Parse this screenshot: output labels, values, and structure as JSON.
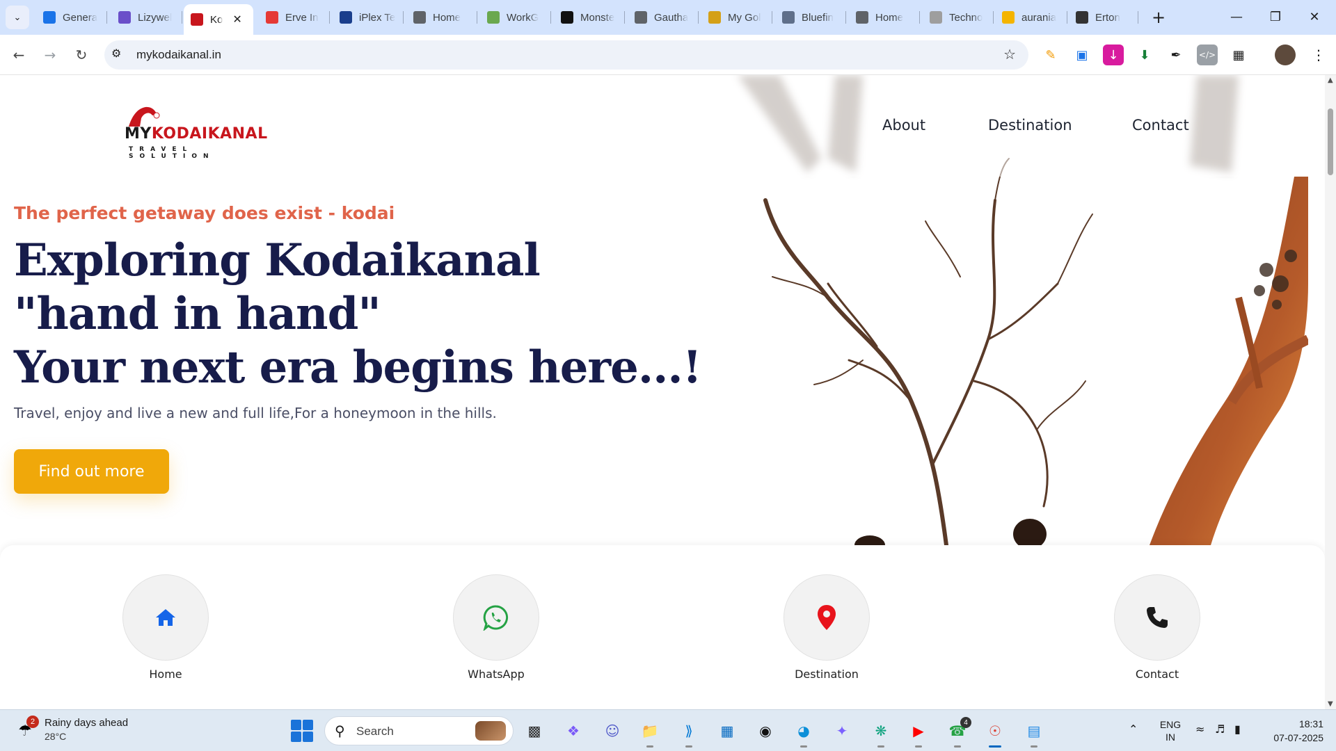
{
  "browser": {
    "tabs": [
      {
        "label": "Genera",
        "favicon": "chart-favicon",
        "favicon_color": "#1a73e8"
      },
      {
        "label": "Lizywel",
        "favicon": "lizywel-favicon",
        "favicon_color": "#6a4fc9"
      },
      {
        "label": "Ko",
        "favicon": "mykodaikanal-favicon",
        "favicon_color": "#c8161d",
        "active": true
      },
      {
        "label": "Erve In",
        "favicon": "erve-favicon",
        "favicon_color": "#e53935"
      },
      {
        "label": "iPlex Te",
        "favicon": "iplex-favicon",
        "favicon_color": "#1a3e8c"
      },
      {
        "label": "Home",
        "favicon": "globe-favicon",
        "favicon_color": "#5f6368"
      },
      {
        "label": "WorkG",
        "favicon": "workg-favicon",
        "favicon_color": "#6aa84f"
      },
      {
        "label": "Monste",
        "favicon": "monster-favicon",
        "favicon_color": "#111111"
      },
      {
        "label": "Gautha",
        "favicon": "globe-favicon",
        "favicon_color": "#5f6368"
      },
      {
        "label": "My Gol",
        "favicon": "hand-favicon",
        "favicon_color": "#d4a017"
      },
      {
        "label": "Bluefin",
        "favicon": "bluefin-favicon",
        "favicon_color": "#5f6f8a"
      },
      {
        "label": "Home",
        "favicon": "globe-favicon",
        "favicon_color": "#5f6368"
      },
      {
        "label": "Techno",
        "favicon": "techno-favicon",
        "favicon_color": "#9e9e9e"
      },
      {
        "label": "aurania",
        "favicon": "aurania-favicon",
        "favicon_color": "#f4b400"
      },
      {
        "label": "Erton",
        "favicon": "erton-favicon",
        "favicon_color": "#333333"
      }
    ],
    "url": "mykodaikanal.in"
  },
  "site": {
    "logo": {
      "prefix": "MY",
      "name": "KODAIKANAL",
      "subtitle": "TRAVEL SOLUTION"
    },
    "nav": [
      "About",
      "Destination",
      "Contact"
    ],
    "hero": {
      "tagline": "The perfect getaway does exist - kodai",
      "headline": [
        "Exploring Kodaikanal",
        "\"hand in hand\"",
        "Your next era begins here...!"
      ],
      "subline": "Travel, enjoy and live a new and full life,For a honeymoon in the hills.",
      "cta": "Find out more"
    },
    "quick_links": [
      {
        "label": "Home",
        "icon": "home-icon",
        "color": "#1565e8"
      },
      {
        "label": "WhatsApp",
        "icon": "whatsapp-icon",
        "color": "#25a244"
      },
      {
        "label": "Destination",
        "icon": "location-pin-icon",
        "color": "#e8141c"
      },
      {
        "label": "Contact",
        "icon": "phone-icon",
        "color": "#1a1a1a"
      }
    ]
  },
  "taskbar": {
    "weather": {
      "title": "Rainy days ahead",
      "temp": "28°C",
      "badge": "2"
    },
    "search_label": "Search",
    "whatsapp_badge": "4",
    "lang": [
      "ENG",
      "IN"
    ],
    "time": "18:31",
    "date": "07-07-2025"
  }
}
